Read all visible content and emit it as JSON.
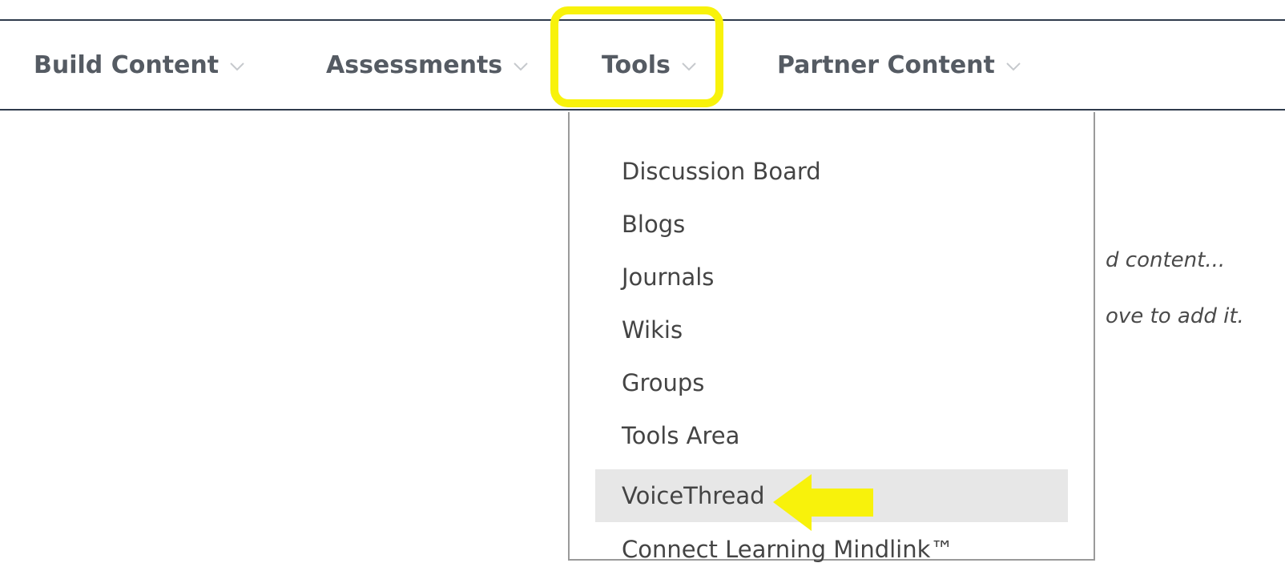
{
  "toolbar": {
    "items": [
      {
        "label": "Build Content"
      },
      {
        "label": "Assessments"
      },
      {
        "label": "Tools"
      },
      {
        "label": "Partner Content"
      }
    ]
  },
  "dropdown": {
    "items": [
      {
        "label": "Discussion Board"
      },
      {
        "label": "Blogs"
      },
      {
        "label": "Journals"
      },
      {
        "label": "Wikis"
      },
      {
        "label": "Groups"
      },
      {
        "label": "Tools Area"
      },
      {
        "label": "VoiceThread"
      },
      {
        "label": "Connect Learning Mindlink™"
      }
    ],
    "selected": "VoiceThread"
  },
  "background_text": {
    "line1": "d content...",
    "line2": "ove to add it."
  },
  "colors": {
    "highlight": "#f8f20b",
    "toolbar_text": "#555b63",
    "divider": "#2f3b4c"
  },
  "icons": {
    "chevron": "chevron-down-icon",
    "annotation_arrow": "arrow-left-icon"
  }
}
